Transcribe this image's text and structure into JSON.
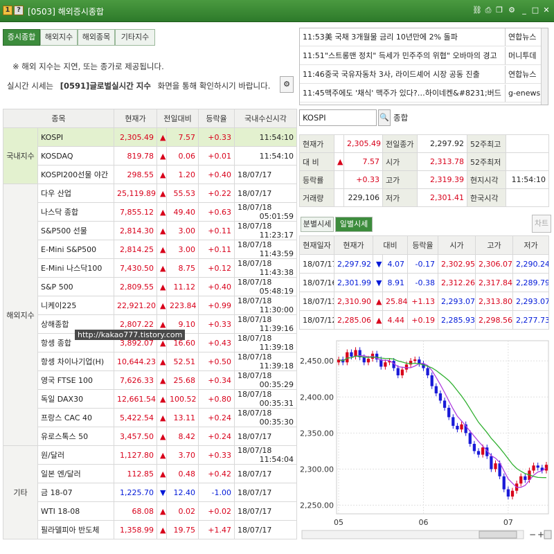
{
  "window": {
    "num_badge": "1",
    "help_badge": "?",
    "title": "[0503] 해외증시종합",
    "icons": [
      "link-icon",
      "print-icon",
      "copy-icon",
      "settings-icon",
      "minimize-icon",
      "maximize-icon",
      "close-icon"
    ]
  },
  "tabs": [
    "증시종합",
    "해외지수",
    "해외종목",
    "기타지수"
  ],
  "notice": {
    "line1": "※ 해외 지수는 지연, 또는 종가로 제공됩니다.",
    "line2_prefix": "실시간 시세는",
    "line2_bold": "[0591]글로벌실시간 지수",
    "line2_suffix": "화면을 통해 확인하시기 바랍니다."
  },
  "table": {
    "columns": [
      "종목",
      "현재가",
      "전일대비",
      "등락율",
      "국내수신시각"
    ],
    "groups": [
      {
        "name": "국내지수",
        "rows": [
          {
            "name": "KOSPI",
            "price": "2,305.49",
            "dir": "up",
            "change": "7.57",
            "rate": "+0.33",
            "date": "",
            "time": "11:54:10",
            "selected": true
          },
          {
            "name": "KOSDAQ",
            "price": "819.78",
            "dir": "up",
            "change": "0.06",
            "rate": "+0.01",
            "date": "",
            "time": "11:54:10"
          },
          {
            "name": "KOSPI200선물 야간",
            "price": "298.55",
            "dir": "up",
            "change": "1.20",
            "rate": "+0.40",
            "date": "18/07/17",
            "time": ""
          }
        ]
      },
      {
        "name": "해외지수",
        "rows": [
          {
            "name": "다우 산업",
            "price": "25,119.89",
            "dir": "up",
            "change": "55.53",
            "rate": "+0.22",
            "date": "18/07/17",
            "time": ""
          },
          {
            "name": "나스닥 종합",
            "price": "7,855.12",
            "dir": "up",
            "change": "49.40",
            "rate": "+0.63",
            "date": "18/07/18",
            "time": "05:01:59"
          },
          {
            "name": "S&P500 선물",
            "price": "2,814.30",
            "dir": "up",
            "change": "3.00",
            "rate": "+0.11",
            "date": "18/07/18",
            "time": "11:23:17"
          },
          {
            "name": "E-Mini S&P500",
            "price": "2,814.25",
            "dir": "up",
            "change": "3.00",
            "rate": "+0.11",
            "date": "18/07/18",
            "time": "11:43:59"
          },
          {
            "name": "E-Mini 나스닥100",
            "price": "7,430.50",
            "dir": "up",
            "change": "8.75",
            "rate": "+0.12",
            "date": "18/07/18",
            "time": "11:43:38"
          },
          {
            "name": "S&P 500",
            "price": "2,809.55",
            "dir": "up",
            "change": "11.12",
            "rate": "+0.40",
            "date": "18/07/18",
            "time": "05:48:19"
          },
          {
            "name": "니케이225",
            "price": "22,921.20",
            "dir": "up",
            "change": "223.84",
            "rate": "+0.99",
            "date": "18/07/18",
            "time": "11:30:00"
          },
          {
            "name": "상해종합",
            "price": "2,807.22",
            "dir": "up",
            "change": "9.10",
            "rate": "+0.33",
            "date": "18/07/18",
            "time": "11:39:16"
          },
          {
            "name": "항셍 종합",
            "price": "3,892.07",
            "dir": "up",
            "change": "16.60",
            "rate": "+0.43",
            "date": "18/07/18",
            "time": "11:39:18"
          },
          {
            "name": "항셍 차이나기업(H)",
            "price": "10,644.23",
            "dir": "up",
            "change": "52.51",
            "rate": "+0.50",
            "date": "18/07/18",
            "time": "11:39:18"
          },
          {
            "name": "영국 FTSE 100",
            "price": "7,626.33",
            "dir": "up",
            "change": "25.68",
            "rate": "+0.34",
            "date": "18/07/18",
            "time": "00:35:29"
          },
          {
            "name": "독일 DAX30",
            "price": "12,661.54",
            "dir": "up",
            "change": "100.52",
            "rate": "+0.80",
            "date": "18/07/18",
            "time": "00:35:31"
          },
          {
            "name": "프랑스 CAC 40",
            "price": "5,422.54",
            "dir": "up",
            "change": "13.11",
            "rate": "+0.24",
            "date": "18/07/18",
            "time": "00:35:30"
          },
          {
            "name": "유로스톡스 50",
            "price": "3,457.50",
            "dir": "up",
            "change": "8.42",
            "rate": "+0.24",
            "date": "18/07/17",
            "time": ""
          }
        ]
      },
      {
        "name": "기타",
        "rows": [
          {
            "name": "원/달러",
            "price": "1,127.80",
            "dir": "up",
            "change": "3.70",
            "rate": "+0.33",
            "date": "18/07/18",
            "time": "11:54:04"
          },
          {
            "name": "일본 엔/달러",
            "price": "112.85",
            "dir": "up",
            "change": "0.48",
            "rate": "+0.42",
            "date": "18/07/17",
            "time": ""
          },
          {
            "name": "금 18-07",
            "price": "1,225.70",
            "dir": "dn",
            "change": "12.40",
            "rate": "-1.00",
            "date": "18/07/17",
            "time": ""
          },
          {
            "name": "WTI 18-08",
            "price": "68.08",
            "dir": "up",
            "change": "0.02",
            "rate": "+0.02",
            "date": "18/07/17",
            "time": ""
          },
          {
            "name": "필라델피아 반도체",
            "price": "1,358.99",
            "dir": "up",
            "change": "19.75",
            "rate": "+1.47",
            "date": "18/07/17",
            "time": ""
          }
        ]
      }
    ]
  },
  "watermark": "http://kakao777.tistory.com",
  "news": [
    {
      "time": "11:53",
      "title": "美 국채 3개월물 금리 10년만에 2% 돌파",
      "source": "연합뉴스"
    },
    {
      "time": "11:51",
      "title": "\"스트롱맨 정치\" 득세가 민주주의 위협\" 오바마의 경고",
      "source": "머니투데"
    },
    {
      "time": "11:46",
      "title": "중국 국유자동차 3사, 라이드셰어 시장 공동 진출",
      "source": "연합뉴스"
    },
    {
      "time": "11:45",
      "title": "맥주에도 '채식' 맥주가 있다?…하이네켄&#8231;버드",
      "source": "g-enews"
    }
  ],
  "search": {
    "value": "KOSPI",
    "name": "종합"
  },
  "detail": {
    "rows": [
      {
        "l1": "현재가",
        "v1": "2,305.49",
        "d1": "",
        "l2": "전일종가",
        "v2": "2,297.92",
        "l3": "52주최고",
        "v3": ""
      },
      {
        "l1": "대 비",
        "v1": "7.57",
        "d1": "up",
        "l2": "시가",
        "v2": "2,313.78",
        "l3": "52주최저",
        "v3": ""
      },
      {
        "l1": "등락률",
        "v1": "+0.33",
        "d1": "",
        "l2": "고가",
        "v2": "2,319.39",
        "l3": "현지시각",
        "v3": "11:54:10"
      },
      {
        "l1": "거래량",
        "v1": "229,106",
        "d1": "",
        "l2": "저가",
        "v2": "2,301.41",
        "l3": "한국시각",
        "v3": ""
      }
    ]
  },
  "period_tabs": [
    "분별시세",
    "일별시세"
  ],
  "chart_button": "차트",
  "daily": {
    "columns": [
      "현재일자",
      "현재가",
      "대비",
      "등락율",
      "시가",
      "고가",
      "저가"
    ],
    "rows": [
      {
        "date": "18/07/17",
        "price": "2,297.92",
        "dir": "dn",
        "change": "4.07",
        "rate": "-0.17",
        "open": "2,302.95",
        "high": "2,306.07",
        "low": "2,290.24"
      },
      {
        "date": "18/07/16",
        "price": "2,301.99",
        "dir": "dn",
        "change": "8.91",
        "rate": "-0.38",
        "open": "2,312.26",
        "high": "2,317.84",
        "low": "2,289.79"
      },
      {
        "date": "18/07/13",
        "price": "2,310.90",
        "dir": "up",
        "change": "25.84",
        "rate": "+1.13",
        "open": "2,293.07",
        "high": "2,313.80",
        "low": "2,293.07"
      },
      {
        "date": "18/07/12",
        "price": "2,285.06",
        "dir": "up",
        "change": "4.44",
        "rate": "+0.19",
        "open": "2,285.93",
        "high": "2,298.56",
        "low": "2,277.73"
      }
    ]
  },
  "chart_data": {
    "type": "candlestick",
    "y_ticks": [
      "2,450.00",
      "2,400.00",
      "2,350.00",
      "2,300.00",
      "2,250.00"
    ],
    "y_tick_values": [
      2450,
      2400,
      2350,
      2300,
      2250
    ],
    "ylim": [
      2238,
      2478
    ],
    "x_ticks": [
      "05",
      "06",
      "07"
    ],
    "x_tick_index": [
      0,
      20,
      40
    ],
    "up_color": "#d8001a",
    "down_color": "#1a1ad8",
    "ma_colors": [
      "#b040e0",
      "#30b030"
    ],
    "closes": [
      2452,
      2448,
      2462,
      2456,
      2465,
      2455,
      2448,
      2453,
      2460,
      2452,
      2442,
      2448,
      2450,
      2440,
      2430,
      2438,
      2445,
      2450,
      2452,
      2446,
      2440,
      2430,
      2415,
      2405,
      2395,
      2385,
      2372,
      2360,
      2355,
      2362,
      2350,
      2335,
      2325,
      2320,
      2330,
      2318,
      2300,
      2308,
      2290,
      2272,
      2262,
      2270,
      2280,
      2290,
      2285,
      2298,
      2305,
      2302,
      2298,
      2306
    ]
  }
}
